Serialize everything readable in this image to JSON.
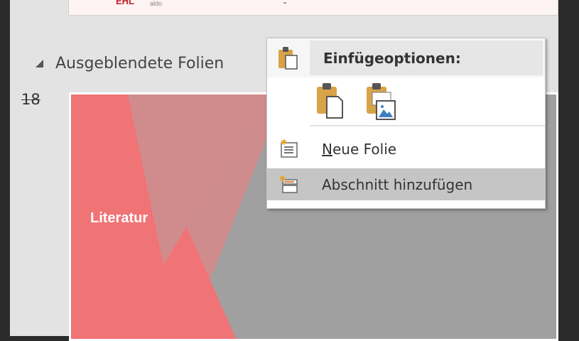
{
  "top_slide": {
    "logo": "EHL",
    "logo_sub": "aldo"
  },
  "section": {
    "title": "Ausgeblendete Folien"
  },
  "slide": {
    "number": "18",
    "title": "Literatur"
  },
  "context_menu": {
    "header": "Einfügeoptionen:",
    "paste_options": [
      "Keep source formatting",
      "Picture"
    ],
    "items": [
      {
        "label": "Neue Folie",
        "accelerator": "N"
      },
      {
        "label": "Abschnitt hinzufügen"
      }
    ]
  },
  "colors": {
    "accent_pink": "#f07375",
    "slide_gray": "#a0a0a0",
    "menu_highlight": "#c5c5c5"
  }
}
